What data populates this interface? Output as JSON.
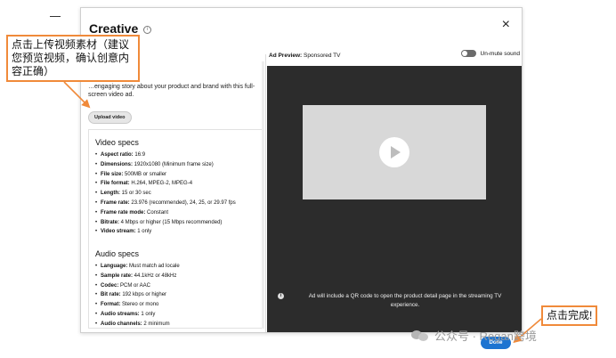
{
  "dialog": {
    "title": "Creative",
    "info_glyph": "i",
    "close_glyph": "×",
    "left": {
      "intro_text": "…engaging story about your product and brand with this full-screen video ad.",
      "upload_label": "Upload video",
      "video_specs_title": "Video specs",
      "video_specs": [
        {
          "key": "Aspect ratio:",
          "value": " 16:9"
        },
        {
          "key": "Dimensions:",
          "value": " 1920x1080 (Minimum frame size)"
        },
        {
          "key": "File size:",
          "value": " 500MB or smaller"
        },
        {
          "key": "File format:",
          "value": " H.264, MPEG-2, MPEG-4"
        },
        {
          "key": "Length:",
          "value": " 15 or 30 sec"
        },
        {
          "key": "Frame rate:",
          "value": " 23.976 (recommended), 24, 25, or 29.97 fps"
        },
        {
          "key": "Frame rate mode:",
          "value": " Constant"
        },
        {
          "key": "Bitrate:",
          "value": " 4 Mbps or higher (15 Mbps recommended)"
        },
        {
          "key": "Video stream:",
          "value": " 1 only"
        }
      ],
      "audio_specs_title": "Audio specs",
      "audio_specs": [
        {
          "key": "Language:",
          "value": " Must match ad locale"
        },
        {
          "key": "Sample rate:",
          "value": " 44.1kHz or 48kHz"
        },
        {
          "key": "Codec:",
          "value": " PCM or AAC"
        },
        {
          "key": "Bit rate:",
          "value": " 192 kbps or higher"
        },
        {
          "key": "Format:",
          "value": " Stereo or mono"
        },
        {
          "key": "Audio streams:",
          "value": " 1 only"
        },
        {
          "key": "Audio channels:",
          "value": " 2 minimum"
        }
      ]
    },
    "right": {
      "preview_label_bold": "Ad Preview:",
      "preview_label_value": " Sponsored TV",
      "unmute_label": "Un-mute sound",
      "qr_info_glyph": "i",
      "qr_note": "Ad will include a QR code to open the product detail page in the streaming TV experience."
    }
  },
  "done_label": "Done",
  "callouts": {
    "upload_hint": "点击上传视频素材（建议您预览视频，确认创意内容正确）",
    "done_hint": "点击完成!"
  },
  "watermark": "公众号 · Regan跨境",
  "colors": {
    "callout_border": "#f08a3a",
    "done_button": "#1d74d1",
    "player_bg": "#2c2c2c"
  }
}
